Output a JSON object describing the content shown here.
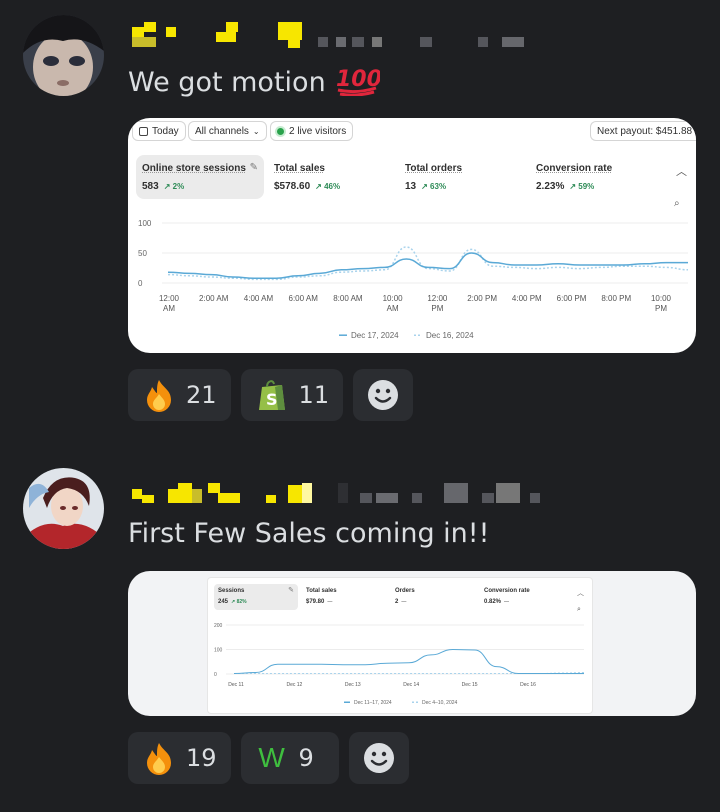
{
  "messages": [
    {
      "text": "We got motion",
      "text_emoji": "hundred-points",
      "embed": {
        "toolbar": {
          "today": "Today",
          "channels": "All channels",
          "live": "2 live visitors",
          "payout": "Next payout: $451.88"
        },
        "metrics": [
          {
            "label": "Online store sessions",
            "value": "583",
            "change": "↗ 2%"
          },
          {
            "label": "Total sales",
            "value": "$578.60",
            "change": "↗ 46%"
          },
          {
            "label": "Total orders",
            "value": "13",
            "change": "↗ 63%"
          },
          {
            "label": "Conversion rate",
            "value": "2.23%",
            "change": "↗ 59%"
          }
        ],
        "chart_data": {
          "type": "line",
          "yticks": [
            "100",
            "50",
            "0"
          ],
          "ylim": [
            0,
            100
          ],
          "xticks": [
            [
              "12:00",
              "AM"
            ],
            [
              "2:00 AM"
            ],
            [
              "4:00 AM"
            ],
            [
              "6:00 AM"
            ],
            [
              "8:00 AM"
            ],
            [
              "10:00",
              "AM"
            ],
            [
              "12:00",
              "PM"
            ],
            [
              "2:00 PM"
            ],
            [
              "4:00 PM"
            ],
            [
              "6:00 PM"
            ],
            [
              "8:00 PM"
            ],
            [
              "10:00",
              "PM"
            ]
          ],
          "series": [
            {
              "name": "Dec 17, 2024",
              "style": "solid",
              "color": "#5aa9d6",
              "values": [
                18,
                16,
                14,
                10,
                8,
                8,
                12,
                16,
                22,
                24,
                26,
                40,
                26,
                24,
                50,
                34,
                30,
                30,
                32,
                30,
                30,
                30,
                32,
                34,
                34
              ]
            },
            {
              "name": "Dec 16, 2024",
              "style": "dashed",
              "color": "#a9d3ec",
              "values": [
                14,
                12,
                10,
                8,
                6,
                6,
                10,
                12,
                18,
                20,
                22,
                60,
                24,
                20,
                56,
                28,
                26,
                24,
                26,
                24,
                26,
                28,
                28,
                26,
                22
              ]
            }
          ]
        }
      },
      "reactions": [
        {
          "emoji": "fire",
          "count": "21"
        },
        {
          "emoji": "shopify-bag",
          "count": "11"
        }
      ]
    },
    {
      "text": "First Few Sales coming in!!",
      "embed": {
        "metrics": [
          {
            "label": "Sessions",
            "value": "245",
            "change": "↗ 82%"
          },
          {
            "label": "Total sales",
            "value": "$79.80",
            "change": "—"
          },
          {
            "label": "Orders",
            "value": "2",
            "change": "—"
          },
          {
            "label": "Conversion rate",
            "value": "0.82%",
            "change": "—"
          }
        ],
        "chart_data": {
          "type": "line",
          "yticks": [
            "200",
            "100",
            "0"
          ],
          "ylim": [
            0,
            200
          ],
          "xticks": [
            "Dec 11",
            "Dec 12",
            "Dec 13",
            "Dec 14",
            "Dec 15",
            "Dec 16"
          ],
          "series": [
            {
              "name": "Dec 11–17, 2024",
              "style": "solid",
              "color": "#5aa9d6",
              "values": [
                2,
                6,
                40,
                40,
                40,
                38,
                38,
                44,
                46,
                78,
                100,
                98,
                30,
                2,
                2,
                2,
                2
              ]
            },
            {
              "name": "Dec 4–10, 2024",
              "style": "dashed",
              "color": "#a9d3ec",
              "values": [
                2,
                2,
                2,
                2,
                2,
                2,
                2,
                2,
                2,
                2,
                2,
                2,
                2,
                2,
                2,
                4,
                6
              ]
            }
          ]
        }
      },
      "reactions": [
        {
          "emoji": "fire",
          "count": "19"
        },
        {
          "emoji": "letter-w",
          "glyph": "W",
          "count": "9"
        }
      ]
    }
  ],
  "colors": {
    "background": "#1e1f22",
    "reaction_bg": "#2b2d31",
    "redacted_yellow": "#f7e600",
    "redacted_gray": "#55565c"
  }
}
